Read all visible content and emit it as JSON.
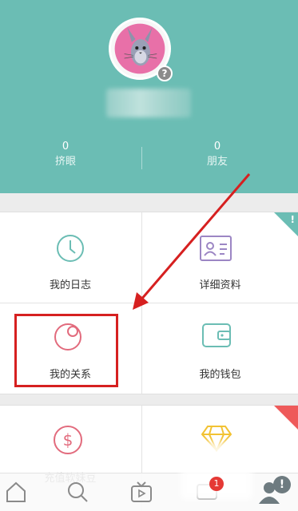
{
  "header": {
    "avatar_badge": "?",
    "stats": [
      {
        "value": "0",
        "label": "挤眼"
      },
      {
        "value": "0",
        "label": "朋友"
      }
    ]
  },
  "menu": {
    "items": [
      {
        "label": "我的日志",
        "icon": "clock-icon"
      },
      {
        "label": "详细资料",
        "icon": "id-card-icon",
        "corner_badge": "!"
      },
      {
        "label": "我的关系",
        "icon": "relationship-icon"
      },
      {
        "label": "我的钱包",
        "icon": "wallet-icon"
      },
      {
        "label": "充值软妹豆",
        "icon": "dollar-coin-icon"
      },
      {
        "label": "",
        "icon": "diamond-icon"
      }
    ]
  },
  "bottom_nav": {
    "items": [
      "home-icon",
      "search-icon",
      "tv-icon",
      "message-icon",
      "profile-icon"
    ],
    "message_badge": "1",
    "profile_badge": "!"
  },
  "colors": {
    "header_bg": "#6bbdb4",
    "accent_teal": "#6bbdb4",
    "accent_pink": "#e26b7d",
    "accent_purple": "#9c86c4",
    "highlight_red": "#d62020"
  }
}
